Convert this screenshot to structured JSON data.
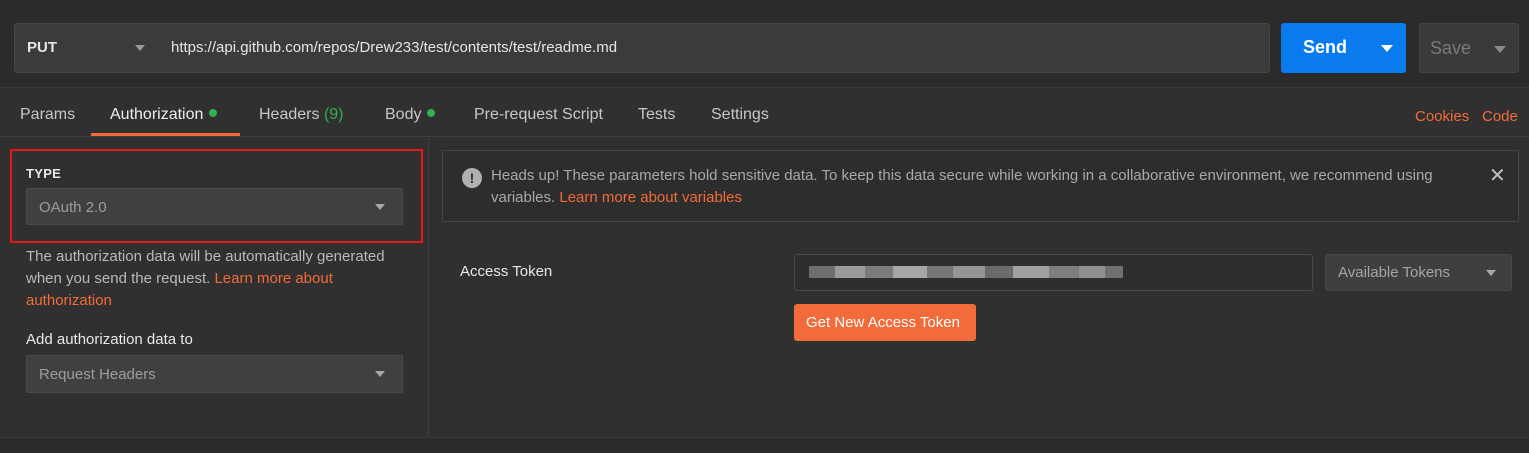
{
  "request": {
    "method": "PUT",
    "url": "https://api.github.com/repos/Drew233/test/contents/test/readme.md",
    "send_label": "Send",
    "save_label": "Save"
  },
  "tabs": [
    {
      "label": "Params"
    },
    {
      "label": "Authorization"
    },
    {
      "label": "Headers",
      "count": "(9)"
    },
    {
      "label": "Body"
    },
    {
      "label": "Pre-request Script"
    },
    {
      "label": "Tests"
    },
    {
      "label": "Settings"
    }
  ],
  "tab_links": {
    "cookies": "Cookies",
    "code": "Code"
  },
  "auth": {
    "type_label": "TYPE",
    "type_value": "OAuth 2.0",
    "description": "The authorization data will be automatically generated when you send the request.",
    "learn_more": "Learn more about authorization",
    "add_to_label": "Add authorization data to",
    "add_to_value": "Request Headers"
  },
  "notice": {
    "text": "Heads up! These parameters hold sensitive data. To keep this data secure while working in a collaborative environment, we recommend using variables.",
    "link": "Learn more about variables"
  },
  "oauth": {
    "access_token_label": "Access Token",
    "available_tokens": "Available Tokens",
    "get_new_label": "Get New Access Token"
  },
  "colors": {
    "accent_orange": "#f26b3a",
    "send_blue": "#097bed",
    "status_green": "#30b04f",
    "highlight_red": "#e0191c"
  }
}
